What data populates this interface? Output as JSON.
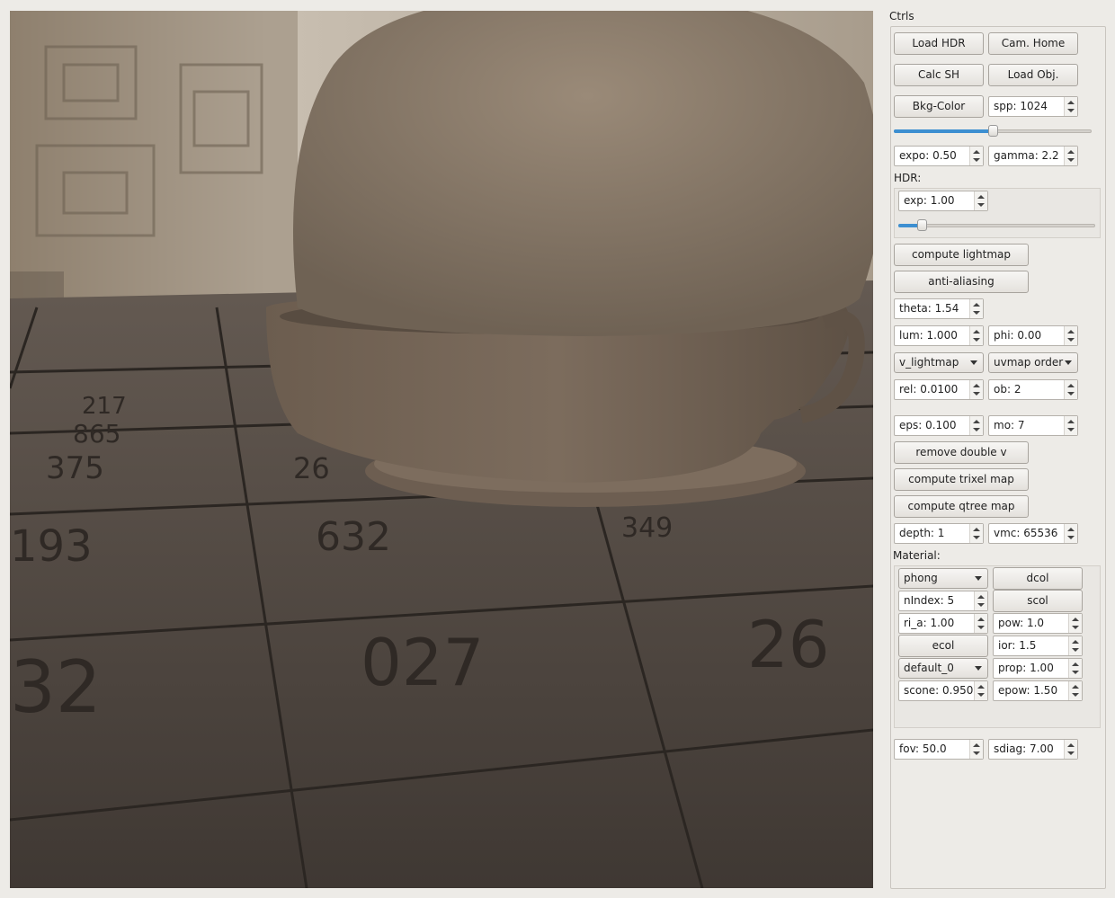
{
  "panel": {
    "title": "Ctrls",
    "load_hdr": "Load HDR",
    "cam_home": "Cam. Home",
    "calc_sh": "Calc SH",
    "load_obj": "Load Obj.",
    "bkg_color": "Bkg-Color",
    "spp": "spp: 1024",
    "spp_slider": 0.5,
    "expo": "expo: 0.50",
    "gamma": "gamma: 2.2",
    "hdr_label": "HDR:",
    "hdr_exp": "exp: 1.00",
    "hdr_slider": 0.12,
    "compute_lightmap": "compute lightmap",
    "anti_aliasing": "anti-aliasing",
    "theta": "theta: 1.54",
    "lum": "lum: 1.000",
    "phi": "phi: 0.00",
    "lightmap_mode": "v_lightmap",
    "uvmap_order": "uvmap order",
    "rel": "rel: 0.0100",
    "ob": "ob: 2",
    "eps": "eps: 0.100",
    "mo": "mo: 7",
    "remove_double_v": "remove double v",
    "compute_trixel_map": "compute trixel map",
    "compute_qtree_map": "compute qtree map",
    "depth": "depth: 1",
    "vmc": "vmc: 65536",
    "material_label": "Material:",
    "material": {
      "shader": "phong",
      "dcol": "dcol",
      "nindex": "nIndex: 5",
      "scol": "scol",
      "ri_a": "ri_a: 1.00",
      "pow": "pow: 1.0",
      "ecol": "ecol",
      "ior": "ior: 1.5",
      "material_name": "default_0",
      "prop": "prop: 1.00",
      "scone": "scone: 0.950",
      "epow": "epow: 1.50"
    },
    "fov": "fov: 50.0",
    "sdiag": "sdiag: 7.00"
  },
  "scene": {
    "floor_numbers": [
      "375",
      "193",
      "632",
      "027",
      "32",
      "217",
      "865",
      "26",
      "349",
      "26"
    ]
  }
}
